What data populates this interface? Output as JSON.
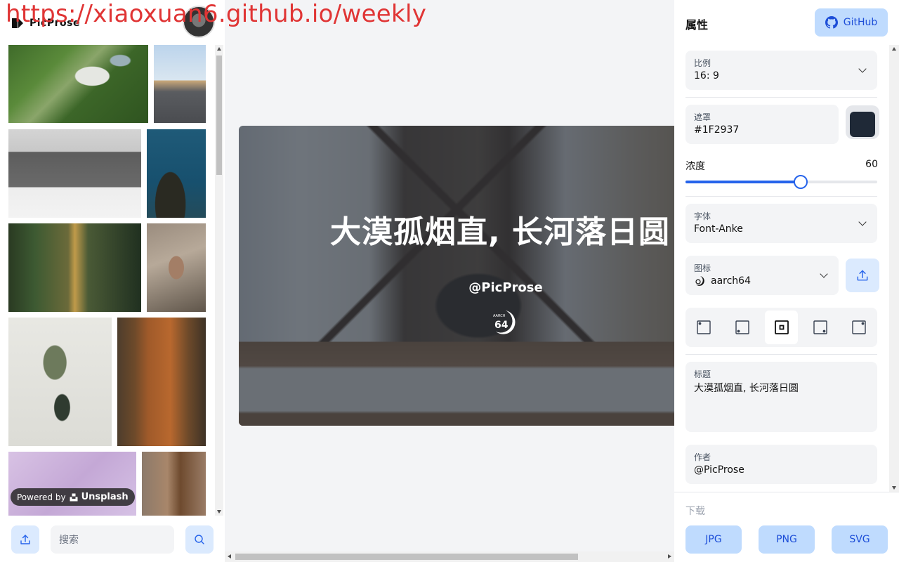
{
  "watermark": "https://xiaoxuan6.github.io/weekly",
  "brand": {
    "name": "PicProse"
  },
  "left": {
    "powered_by": "Powered by",
    "powered_brand": "Unsplash",
    "search_placeholder": "搜索"
  },
  "canvas": {
    "title": "大漠孤烟直, 长河落日圆",
    "author": "@PicProse",
    "mask_color": "#1F2937",
    "mask_opacity": 60
  },
  "props": {
    "title": "属性",
    "github_label": "GitHub",
    "ratio": {
      "label": "比例",
      "value": "16: 9"
    },
    "mask": {
      "label": "遮罩",
      "value": "#1F2937"
    },
    "opacity": {
      "label": "浓度",
      "value": "60"
    },
    "font": {
      "label": "字体",
      "value": "Font-Anke"
    },
    "icon": {
      "label": "图标",
      "value": "aarch64"
    },
    "layout_selected": 2,
    "heading": {
      "label": "标题",
      "value": "大漠孤烟直, 长河落日圆"
    },
    "author": {
      "label": "作者",
      "value": "@PicProse"
    },
    "download_label": "下载",
    "download": [
      "JPG",
      "PNG",
      "SVG"
    ]
  }
}
